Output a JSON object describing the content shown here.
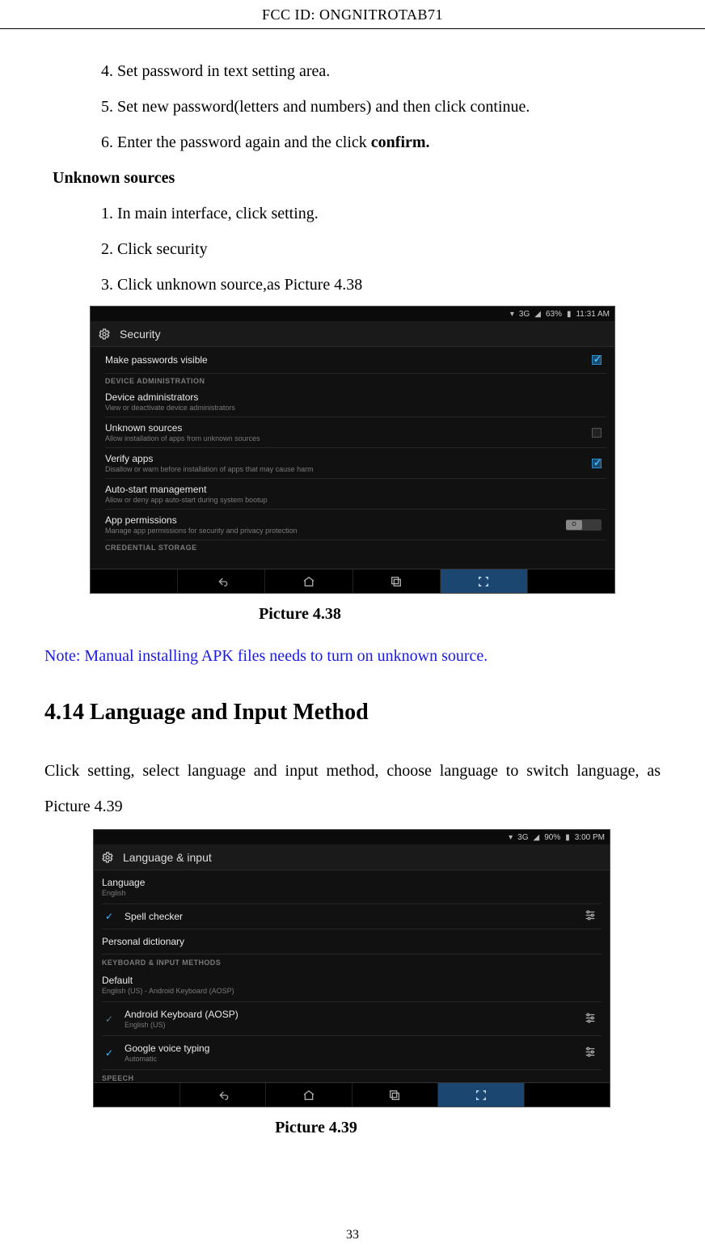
{
  "header": "FCC ID:  ONGNITROTAB71",
  "steps_a": [
    "4. Set password in text setting area.",
    "5. Set new password(letters and numbers) and then click continue."
  ],
  "step6_pre": "6. Enter the password again and the click ",
  "step6_bold": "confirm.",
  "unknown_heading": "Unknown sources",
  "unknown_steps": [
    "1. In main interface, click setting.",
    "2. Click security",
    "3. Click unknown source,as Picture 4.38"
  ],
  "shot1": {
    "status": {
      "signal": "3G",
      "battery": "63%",
      "time": "11:31 AM"
    },
    "title": "Security",
    "items": [
      {
        "type": "check",
        "title": "Make passwords visible",
        "checked": true
      },
      {
        "type": "cat",
        "title": "DEVICE ADMINISTRATION"
      },
      {
        "type": "sub",
        "title": "Device administrators",
        "sub": "View or deactivate device administrators"
      },
      {
        "type": "check",
        "title": "Unknown sources",
        "sub": "Allow installation of apps from unknown sources",
        "checked": false
      },
      {
        "type": "check",
        "title": "Verify apps",
        "sub": "Disallow or warn before installation of apps that may cause harm",
        "checked": true
      },
      {
        "type": "sub",
        "title": "Auto-start management",
        "sub": "Allow or deny app auto-start during system bootup"
      },
      {
        "type": "toggle",
        "title": "App permissions",
        "sub": "Manage app permissions for security and privacy protection",
        "toggle": "O"
      },
      {
        "type": "cat",
        "title": "CREDENTIAL STORAGE"
      }
    ]
  },
  "caption1": "Picture 4.38",
  "note": "Note:    Manual installing APK files needs to turn on unknown source.",
  "section": "4.14 Language and Input Method",
  "para": "Click setting, select language and input method, choose language to switch language, as Picture 4.39",
  "shot2": {
    "status": {
      "signal": "3G",
      "battery": "90%",
      "time": "3:00 PM"
    },
    "title": "Language & input",
    "items": [
      {
        "type": "sub",
        "title": "Language",
        "sub": "English"
      },
      {
        "type": "icon",
        "title": "Spell checker",
        "icon": "check",
        "right": "sliders"
      },
      {
        "type": "plain",
        "title": "Personal dictionary"
      },
      {
        "type": "cat",
        "title": "KEYBOARD & INPUT METHODS"
      },
      {
        "type": "sub",
        "title": "Default",
        "sub": "English (US) - Android Keyboard (AOSP)"
      },
      {
        "type": "icon",
        "title": "Android Keyboard (AOSP)",
        "sub": "English (US)",
        "icon": "check-dim",
        "right": "sliders",
        "indent": true
      },
      {
        "type": "icon",
        "title": "Google voice typing",
        "sub": "Automatic",
        "icon": "check",
        "right": "sliders",
        "indent": true
      },
      {
        "type": "cat",
        "title": "SPEECH"
      }
    ]
  },
  "caption2": "Picture 4.39",
  "pagenum": "33"
}
